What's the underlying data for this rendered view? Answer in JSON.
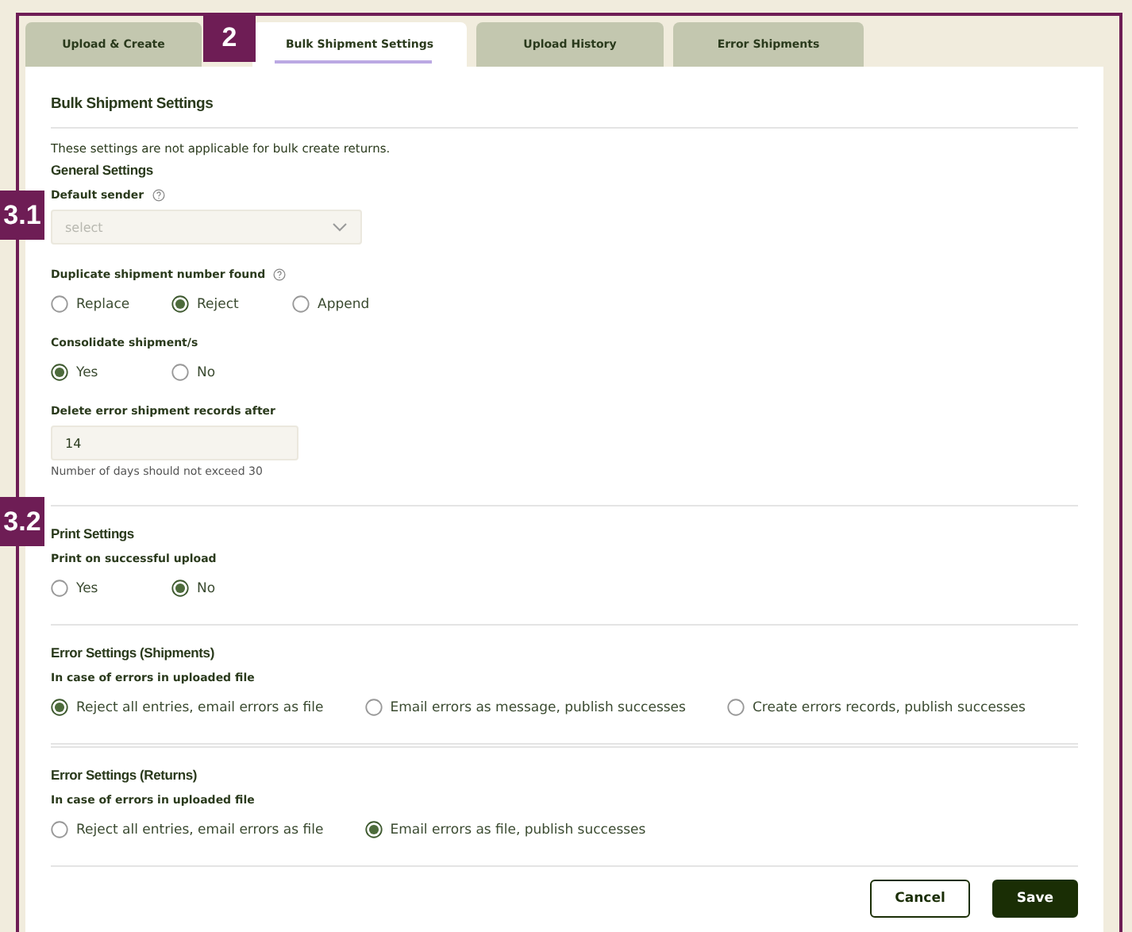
{
  "tabs": [
    {
      "label": "Upload & Create",
      "selected": false
    },
    {
      "label": "Bulk Shipment Settings",
      "selected": true
    },
    {
      "label": "Upload History",
      "selected": false
    },
    {
      "label": "Error Shipments",
      "selected": false
    }
  ],
  "callouts": [
    {
      "label": "2"
    },
    {
      "label": "3.1"
    },
    {
      "label": "3.2"
    }
  ],
  "panel": {
    "title": "Bulk Shipment Settings",
    "note": "These settings are not applicable for bulk create returns.",
    "sections": [
      {
        "title": "General Settings",
        "fields": [
          {
            "kind": "select",
            "label": "Default sender",
            "help": true,
            "placeholder": "select"
          },
          {
            "kind": "radio",
            "label": "Duplicate shipment number found",
            "help": true,
            "options": [
              {
                "label": "Replace",
                "selected": false
              },
              {
                "label": "Reject",
                "selected": true
              },
              {
                "label": "Append",
                "selected": false
              }
            ]
          },
          {
            "kind": "radio",
            "label": "Consolidate shipment/s",
            "help": false,
            "options": [
              {
                "label": "Yes",
                "selected": true
              },
              {
                "label": "No",
                "selected": false
              }
            ]
          },
          {
            "kind": "input",
            "label": "Delete error shipment records after",
            "help": false,
            "value": "14",
            "hint": "Number of days should not exceed 30"
          }
        ]
      },
      {
        "title": "Print Settings",
        "fields": [
          {
            "kind": "radio",
            "label": "Print on successful upload",
            "help": false,
            "options": [
              {
                "label": "Yes",
                "selected": false
              },
              {
                "label": "No",
                "selected": true
              }
            ]
          }
        ]
      },
      {
        "title": "Error Settings (Shipments)",
        "fields": [
          {
            "kind": "radio",
            "label": "In case of errors in uploaded file",
            "help": false,
            "options": [
              {
                "label": "Reject all entries, email errors as file",
                "selected": true
              },
              {
                "label": "Email errors as message, publish successes",
                "selected": false
              },
              {
                "label": "Create errors records, publish successes",
                "selected": false
              }
            ]
          }
        ]
      },
      {
        "title": "Error Settings (Returns)",
        "fields": [
          {
            "kind": "radio",
            "label": "In case of errors in uploaded file",
            "help": false,
            "options": [
              {
                "label": "Reject all entries, email errors as file",
                "selected": false
              },
              {
                "label": "Email errors as file, publish successes",
                "selected": true
              }
            ]
          }
        ]
      }
    ]
  },
  "buttons": [
    {
      "label": "Cancel",
      "kind": "secondary"
    },
    {
      "label": "Save",
      "kind": "primary"
    }
  ]
}
